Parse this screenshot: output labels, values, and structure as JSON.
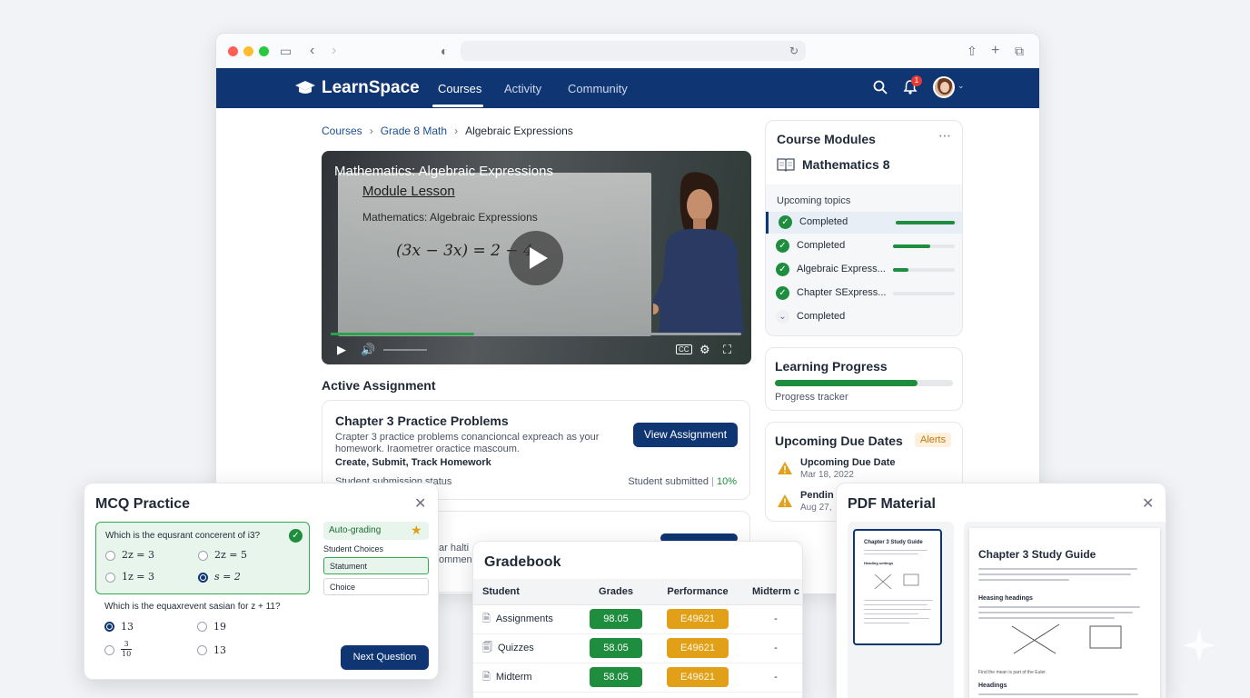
{
  "app": {
    "name": "LearnSpace"
  },
  "nav": {
    "courses": "Courses",
    "activity": "Activity",
    "community": "Community",
    "notification_count": "1"
  },
  "breadcrumb": {
    "level1": "Courses",
    "level2": "Grade 8 Math",
    "current": "Algebraic Expressions"
  },
  "video": {
    "title": "Mathematics: Algebraic Expressions",
    "board_heading": "Module Lesson",
    "board_subtitle": "Mathematics: Algebraic Expressions",
    "board_equation": "(3x − 3x) = 2 − 4",
    "progress": 0.35,
    "cc_label": "CC"
  },
  "assignment": {
    "section_title": "Active Assignment",
    "title": "Chapter 3 Practice Problems",
    "description": "Crapter 3 practice problems conancioncal expreach as your homework. Iraometrer oractice mascoum.",
    "tags": "Create, Submit, Track Homework",
    "status_label": "Student submission status",
    "submitted_label": "Student submitted",
    "submitted_pct": "10%",
    "button": "View Assignment"
  },
  "second_card": {
    "text_line1": "ar halti",
    "text_line2": "ommen"
  },
  "modules": {
    "title": "Course Modules",
    "course": "Mathematics 8",
    "upcoming_label": "Upcoming topics",
    "items": [
      {
        "label": "Completed",
        "progress": 0.95,
        "done": true
      },
      {
        "label": "Completed",
        "progress": 0.6,
        "done": true
      },
      {
        "label": "Algebraic Express...",
        "progress": 0.25,
        "done": true
      },
      {
        "label": "Chapter SExpress...",
        "progress": 0.0,
        "done": true
      },
      {
        "label": "Completed",
        "progress": null,
        "done": false
      }
    ]
  },
  "learning_progress": {
    "title": "Learning Progress",
    "label": "Progress tracker",
    "progress": 0.8
  },
  "due_dates": {
    "title": "Upcoming Due Dates",
    "badge": "Alerts",
    "items": [
      {
        "title": "Upcoming Due Date",
        "date": "Mar 18, 2022"
      },
      {
        "title": "Pendin",
        "date": "Aug 27,"
      }
    ]
  },
  "mcq": {
    "title": "MCQ Practice",
    "q1": "Which is the equsrant concerent of i3?",
    "q1_opts": [
      "2z = 3",
      "2z = 5",
      "1z = 3",
      "s = 2"
    ],
    "q2": "Which is the equaxrevent sasian for z + 11?",
    "q2_opts": [
      "13",
      "19",
      "13"
    ],
    "q2_frac_num": "3",
    "q2_frac_den": "10",
    "autograding": "Auto-grading",
    "choices_label": "Student Choices",
    "choice1": "Statument",
    "choice2": "Choice",
    "next": "Next Question"
  },
  "gradebook": {
    "title": "Gradebook",
    "headers": [
      "Student",
      "Grades",
      "Performance",
      "Midterm c"
    ],
    "rows": [
      {
        "student": "Assignments",
        "grade": "98.05",
        "perf": "E49621",
        "midterm": "-"
      },
      {
        "student": "Quizzes",
        "grade": "58.05",
        "perf": "E49621",
        "midterm": "-"
      },
      {
        "student": "Midterm",
        "grade": "58.05",
        "perf": "E49621",
        "midterm": "-"
      }
    ]
  },
  "pdf": {
    "title": "PDF Material",
    "thumb_title": "Chapter 3 Study Guide",
    "thumb_sub": "Heading settings",
    "doc_title": "Chapter 3 Study Guide",
    "doc_h1": "Heasing headings",
    "doc_h2": "Headings",
    "doc_caption": "Find the mean is part of the Euler."
  },
  "colors": {
    "brand": "#0f3572",
    "success": "#1e8e3e",
    "warning": "#e2a019"
  }
}
